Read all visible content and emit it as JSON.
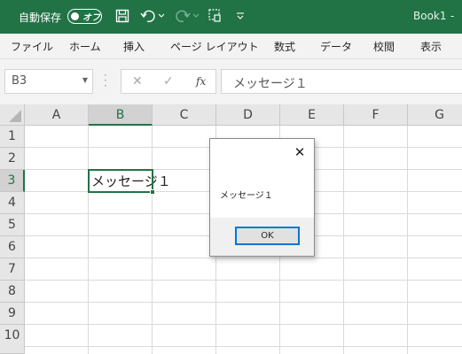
{
  "titlebar": {
    "autosave_label": "自動保存",
    "toggle_text": "オフ",
    "workbook_title": "Book1",
    "title_separator": "-",
    "icons": [
      "save-icon",
      "undo-icon",
      "redo-icon",
      "touch-mode-icon",
      "customize-quick-access-icon"
    ],
    "bg_color": "#217346"
  },
  "menu": {
    "items": [
      "ファイル",
      "ホーム",
      "挿入",
      "ページ レイアウト",
      "数式",
      "データ",
      "校閲",
      "表示"
    ]
  },
  "formula_bar": {
    "name_box": "B3",
    "cancel_icon": "✕",
    "enter_icon": "✓",
    "fx_label": "fx",
    "content": "メッセージ１"
  },
  "grid": {
    "columns": [
      "A",
      "B",
      "C",
      "D",
      "E",
      "F",
      "G"
    ],
    "rows": [
      "1",
      "2",
      "3",
      "4",
      "5",
      "6",
      "7",
      "8",
      "9",
      "10"
    ],
    "selected_column": "B",
    "selected_row": "3",
    "active_cell_value": "メッセージ１",
    "accent_color": "#217346"
  },
  "dialog": {
    "close_label": "✕",
    "message": "メッセージ１",
    "ok_label": "OK"
  }
}
